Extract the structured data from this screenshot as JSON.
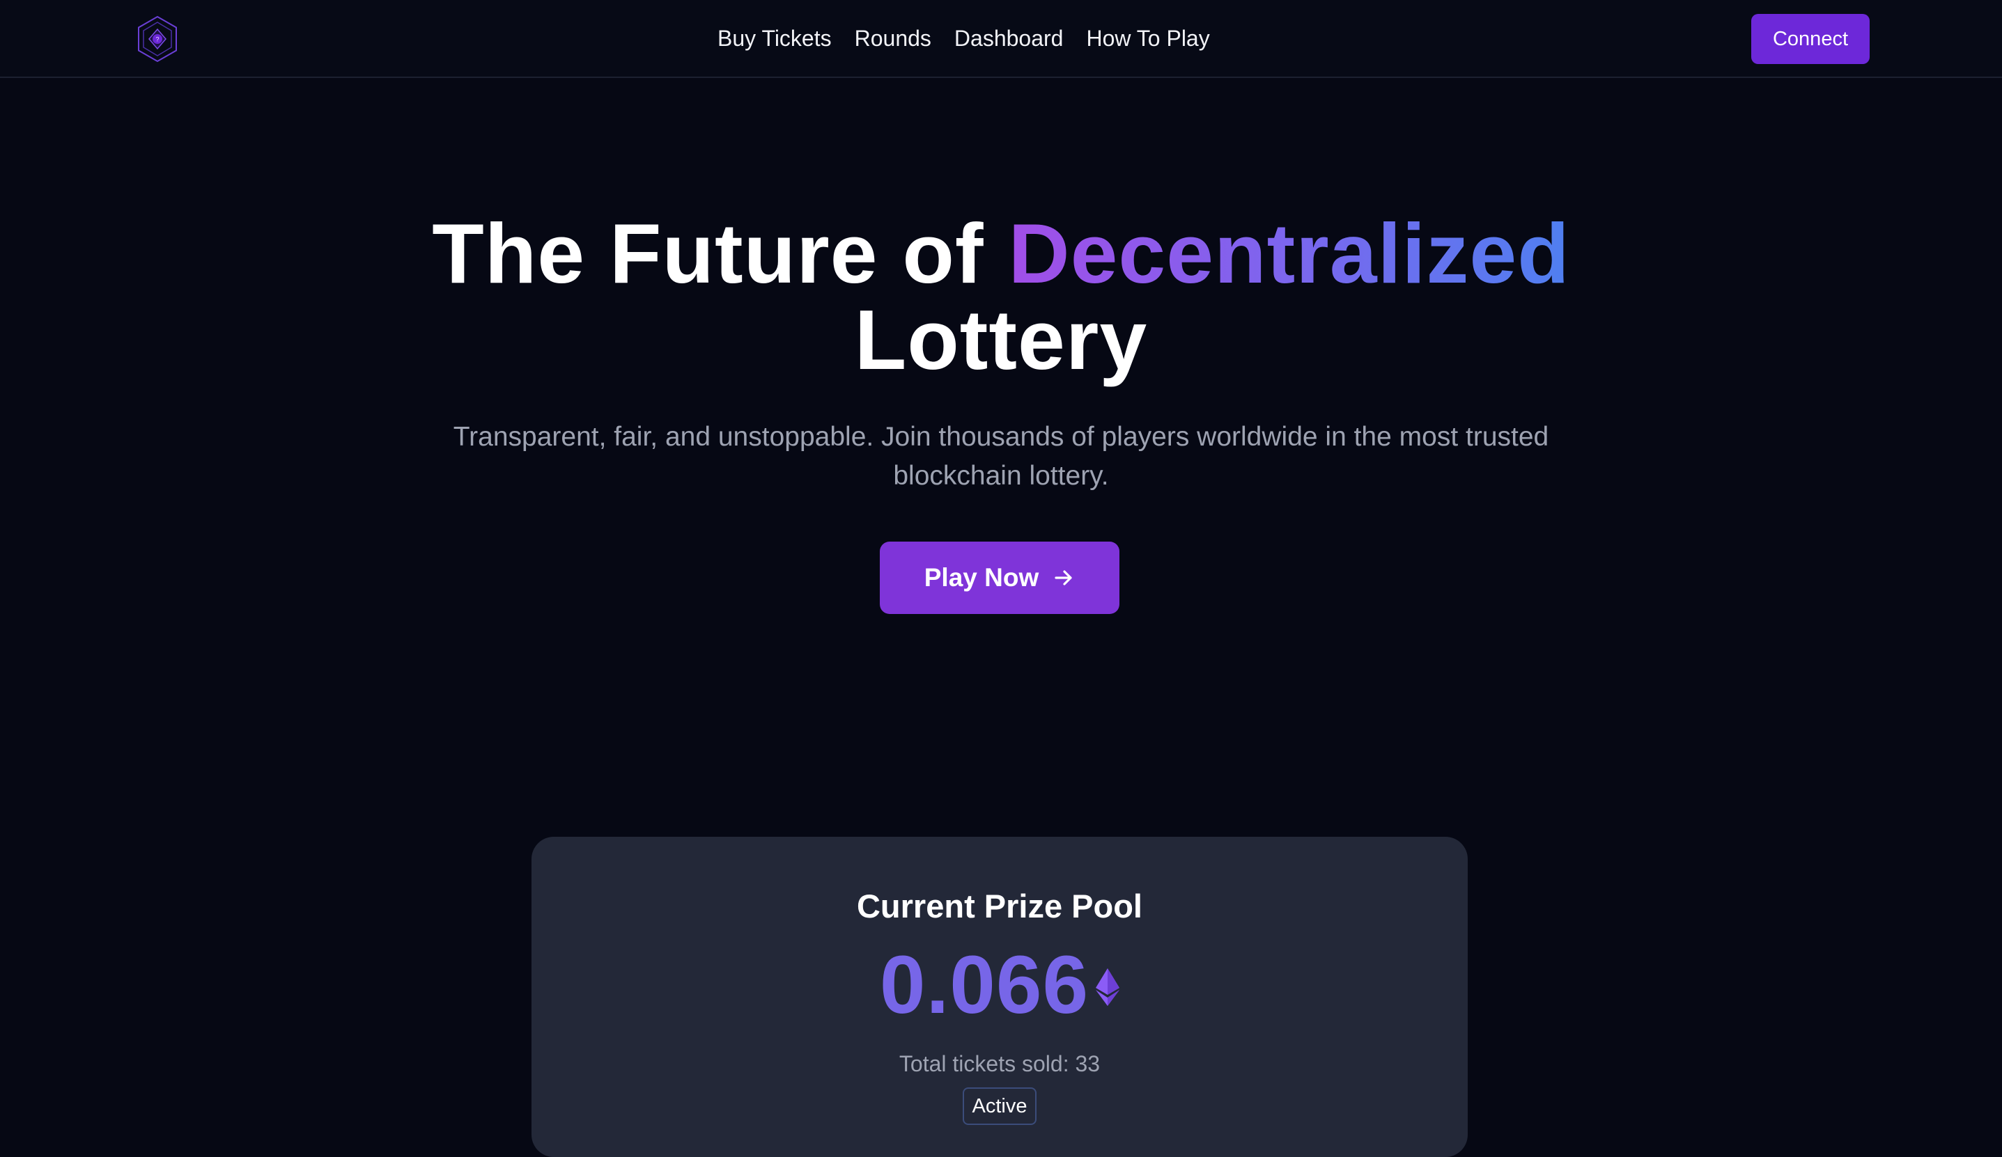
{
  "nav": {
    "logo_icon": "hexagon-lottery-logo-icon",
    "links": [
      {
        "label": "Buy Tickets"
      },
      {
        "label": "Rounds"
      },
      {
        "label": "Dashboard"
      },
      {
        "label": "How To Play"
      }
    ],
    "connect_label": "Connect"
  },
  "hero": {
    "title_part1": "The Future of ",
    "title_highlight": "Decentralized",
    "title_part2": "Lottery",
    "subtitle": "Transparent, fair, and unstoppable. Join thousands of players worldwide in the most trusted blockchain lottery.",
    "cta_label": "Play Now",
    "cta_icon": "arrow-right-icon"
  },
  "prize_card": {
    "title": "Current Prize Pool",
    "pool_value": "0.066",
    "currency_icon": "ethereum-icon",
    "tickets_sold": "Total tickets sold: 33",
    "status": "Active"
  },
  "colors": {
    "background": "#060814",
    "accent": "#6d28d9",
    "cta": "#7f34d9",
    "card": "#232838",
    "pool_value": "#7766e8",
    "gradient_start": "#a14ee8",
    "gradient_end": "#4f7ff0",
    "muted_text": "#9ea3b2"
  }
}
